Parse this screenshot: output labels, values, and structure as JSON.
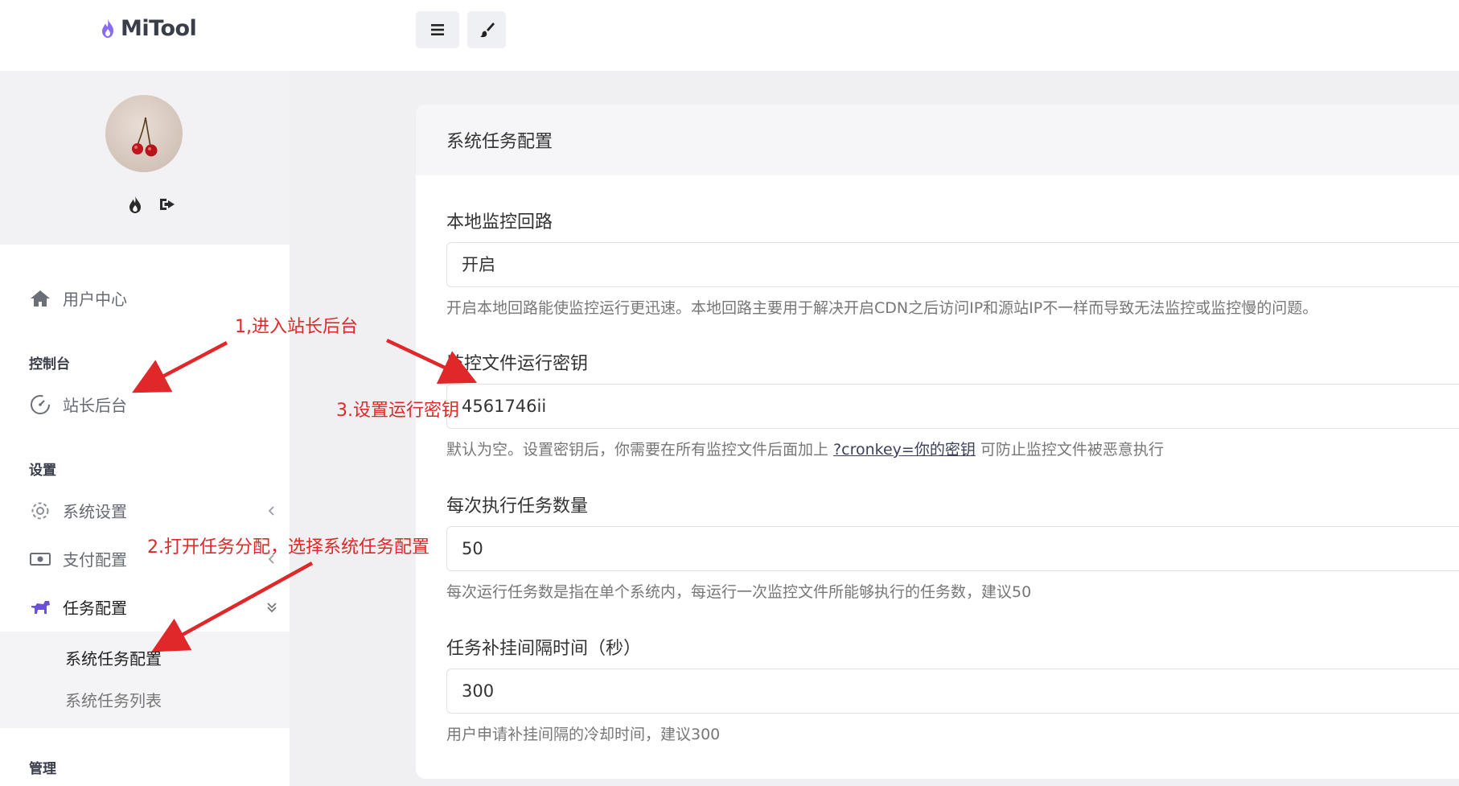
{
  "header": {
    "logo_text": "MiTool",
    "menu_button_icon": "hamburger-menu-icon",
    "theme_button_icon": "paint-brush-icon"
  },
  "profile": {
    "avatar_alt": "cherry-avatar",
    "icons": [
      "flame-icon",
      "logout-icon"
    ]
  },
  "sidebar": {
    "user_center": "用户中心",
    "section_console": "控制台",
    "admin_backend": "站长后台",
    "section_settings": "设置",
    "system_settings": "系统设置",
    "payment_config": "支付配置",
    "task_config": "任务配置",
    "sub_items": [
      "系统任务配置",
      "系统任务列表"
    ],
    "section_manage": "管理"
  },
  "card": {
    "title": "系统任务配置",
    "fields": [
      {
        "label": "本地监控回路",
        "value": "开启",
        "hint": "开启本地回路能使监控运行更迅速。本地回路主要用于解决开启CDN之后访问IP和源站IP不一样而导致无法监控或监控慢的问题。"
      },
      {
        "label": "监控文件运行密钥",
        "value": "4561746ii",
        "hint_before": "默认为空。设置密钥后，你需要在所有监控文件后面加上 ",
        "hint_code": "?cronkey=你的密钥",
        "hint_after": " 可防止监控文件被恶意执行"
      },
      {
        "label": "每次执行任务数量",
        "value": "50",
        "hint": "每次运行任务数是指在单个系统内，每运行一次监控文件所能够执行的任务数，建议50"
      },
      {
        "label": "任务补挂间隔时间（秒）",
        "value": "300",
        "hint": "用户申请补挂间隔的冷却时间，建议300"
      }
    ]
  },
  "annotations": {
    "step1": "1,进入站长后台",
    "step2": "2.打开任务分配，选择系统任务配置",
    "step3": "3.设置运行密钥",
    "color": "#e0282a"
  }
}
